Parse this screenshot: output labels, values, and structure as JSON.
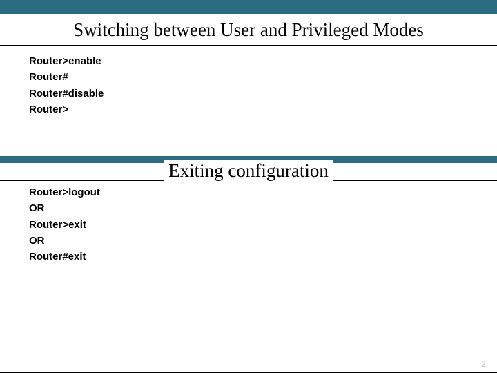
{
  "section1": {
    "title": "Switching between User and Privileged Modes",
    "lines": [
      "Router>enable",
      "Router#",
      "Router#disable",
      "Router>"
    ]
  },
  "section2": {
    "title": "Exiting configuration",
    "lines": [
      "Router>logout",
      "OR",
      "Router>exit",
      "OR",
      "Router#exit"
    ]
  },
  "page_number": "2"
}
